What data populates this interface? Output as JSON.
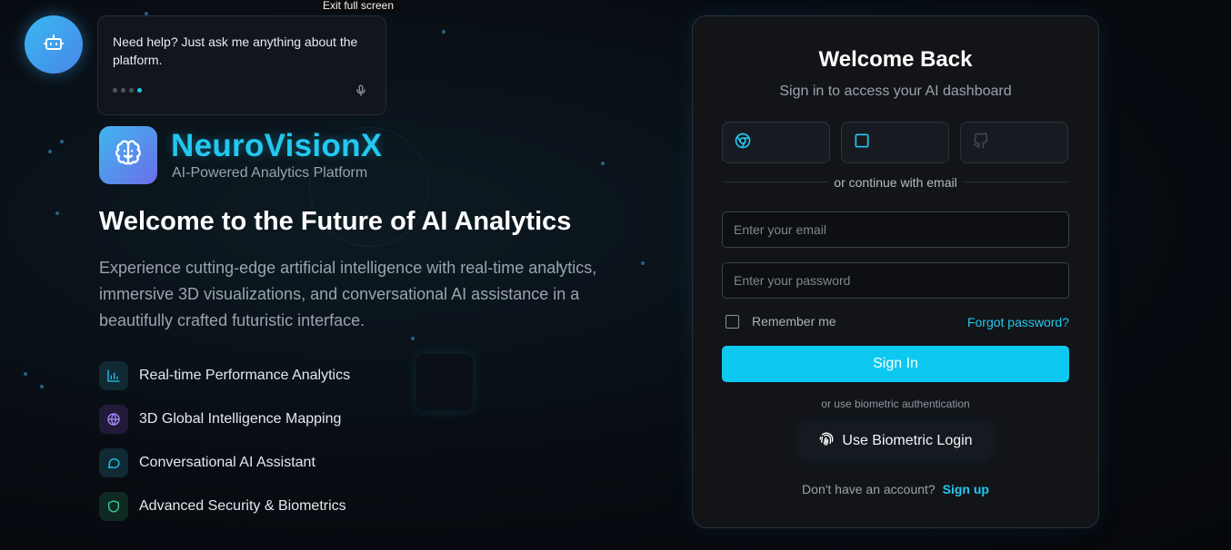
{
  "fullscreen": {
    "exit_label": "Exit full screen"
  },
  "assistant": {
    "icon": "bot-icon",
    "message": "Need help? Just ask me anything about the platform.",
    "mic_icon": "microphone-icon"
  },
  "brand": {
    "name": "NeuroVisionX",
    "tagline": "AI-Powered Analytics Platform",
    "logo_icon": "brain-icon"
  },
  "hero": {
    "title": "Welcome to the Future of AI Analytics",
    "description": "Experience cutting-edge artificial intelligence with real-time analytics, immersive 3D visualizations, and conversational AI assistance in a beautifully crafted futuristic interface."
  },
  "features": [
    {
      "label": "Real-time Performance Analytics",
      "icon": "bar-chart-icon",
      "color": "#22c8f0"
    },
    {
      "label": "3D Global Intelligence Mapping",
      "icon": "globe-icon",
      "color": "#a78bfa"
    },
    {
      "label": "Conversational AI Assistant",
      "icon": "chat-icon",
      "color": "#22c8f0"
    },
    {
      "label": "Advanced Security & Biometrics",
      "icon": "shield-icon",
      "color": "#34d399"
    }
  ],
  "login": {
    "title": "Welcome Back",
    "subtitle": "Sign in to access your AI dashboard",
    "social": [
      {
        "icon": "chrome-icon"
      },
      {
        "icon": "square-icon"
      },
      {
        "icon": "github-icon"
      }
    ],
    "divider_text": "or continue with email",
    "email_placeholder": "Enter your email",
    "password_placeholder": "Enter your password",
    "remember_label": "Remember me",
    "forgot_label": "Forgot password?",
    "signin_label": "Sign In",
    "biometric_text": "or use biometric authentication",
    "biometric_label": "Use Biometric Login",
    "biometric_icon": "fingerprint-icon",
    "no_account_text": "Don't have an account?",
    "signup_label": "Sign up"
  },
  "colors": {
    "accent": "#22c8f0",
    "background": "#080c12",
    "card": "#121418"
  }
}
